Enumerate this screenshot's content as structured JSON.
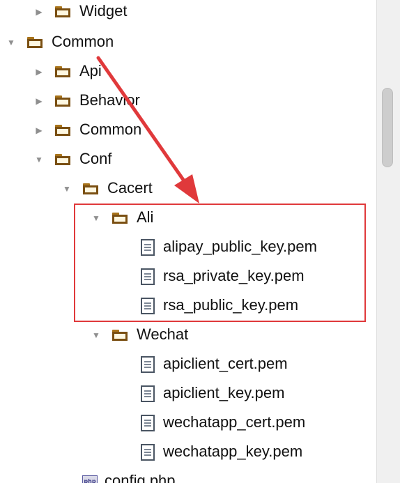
{
  "tree": {
    "rows": [
      {
        "label": "Widget",
        "type": "folder",
        "expanded": false,
        "level": 1
      },
      {
        "label": "Common",
        "type": "folder",
        "expanded": true,
        "level": 0
      },
      {
        "label": "Api",
        "type": "folder",
        "expanded": false,
        "level": 1
      },
      {
        "label": "Behavior",
        "type": "folder",
        "expanded": false,
        "level": 1
      },
      {
        "label": "Common",
        "type": "folder",
        "expanded": false,
        "level": 1
      },
      {
        "label": "Conf",
        "type": "folder",
        "expanded": true,
        "level": 1
      },
      {
        "label": "Cacert",
        "type": "folder",
        "expanded": true,
        "level": 2
      },
      {
        "label": "Ali",
        "type": "folder",
        "expanded": true,
        "level": 3
      },
      {
        "label": "alipay_public_key.pem",
        "type": "file",
        "level": 4
      },
      {
        "label": "rsa_private_key.pem",
        "type": "file",
        "level": 4
      },
      {
        "label": "rsa_public_key.pem",
        "type": "file",
        "level": 4
      },
      {
        "label": "Wechat",
        "type": "folder",
        "expanded": true,
        "level": 3
      },
      {
        "label": "apiclient_cert.pem",
        "type": "file",
        "level": 4
      },
      {
        "label": "apiclient_key.pem",
        "type": "file",
        "level": 4
      },
      {
        "label": "wechatapp_cert.pem",
        "type": "file",
        "level": 4
      },
      {
        "label": "wechatapp_key.pem",
        "type": "file",
        "level": 4
      },
      {
        "label": "config.php",
        "type": "php",
        "level": 2
      }
    ]
  },
  "colors": {
    "highlight": "#e0393b",
    "folder_outline": "#7a4f12",
    "twisty": "#8f8f8f"
  },
  "icons": {
    "expanded": "triangle-down-icon",
    "collapsed": "triangle-right-icon",
    "folder": "folder-icon",
    "file": "text-file-icon",
    "php": "php-file-icon"
  }
}
